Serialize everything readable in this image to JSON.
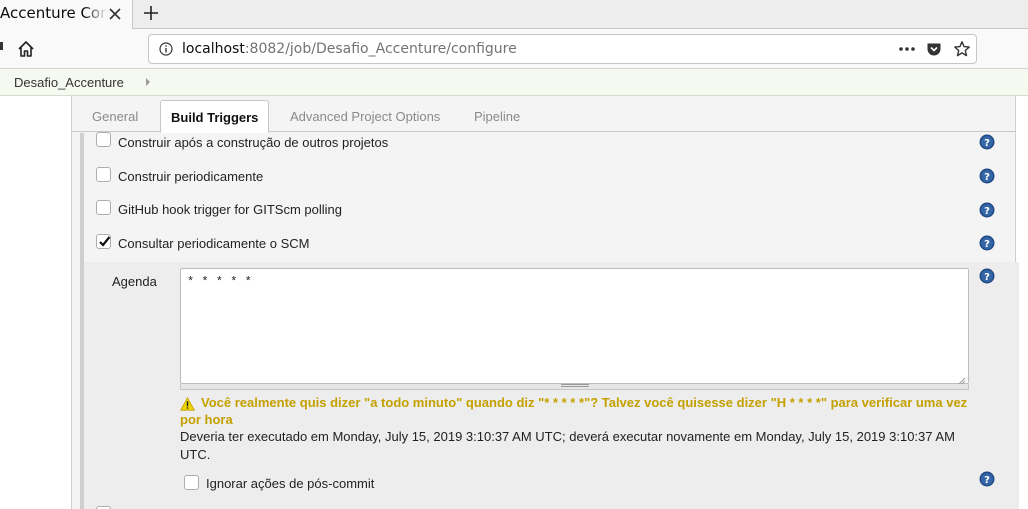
{
  "browser": {
    "tab_title": "Accenture Configuration",
    "url_host": "localhost",
    "url_rest": ":8082/job/Desafio_Accenture/configure"
  },
  "breadcrumb": {
    "items": [
      "Desafio_Accenture"
    ]
  },
  "config": {
    "tabs": [
      {
        "label": "General",
        "active": false
      },
      {
        "label": "Build Triggers",
        "active": true
      },
      {
        "label": "Advanced Project Options",
        "active": false
      },
      {
        "label": "Pipeline",
        "active": false
      }
    ],
    "triggers": [
      {
        "label": "Construir após a construção de outros projetos",
        "checked": false
      },
      {
        "label": "Construir periodicamente",
        "checked": false
      },
      {
        "label": "GitHub hook trigger for GITScm polling",
        "checked": false
      },
      {
        "label": "Consultar periodicamente o SCM",
        "checked": true
      }
    ],
    "scm": {
      "agenda_label": "Agenda",
      "agenda_value": "* * * * *",
      "warning": "Você realmente quis dizer \"a todo minuto\" quando diz \"* * * * *\"? Talvez você quisesse dizer \"H * * * *\" para verificar uma vez por hora",
      "info": "Deveria ter executado em Monday, July 15, 2019 3:10:37 AM UTC; deverá executar novamente em Monday, July 15, 2019 3:10:37 AM UTC.",
      "ignore_label": "Ignorar ações de pós-commit",
      "ignore_checked": false
    }
  },
  "colors": {
    "warning": "#c4a000",
    "help_icon": "#204a87"
  }
}
